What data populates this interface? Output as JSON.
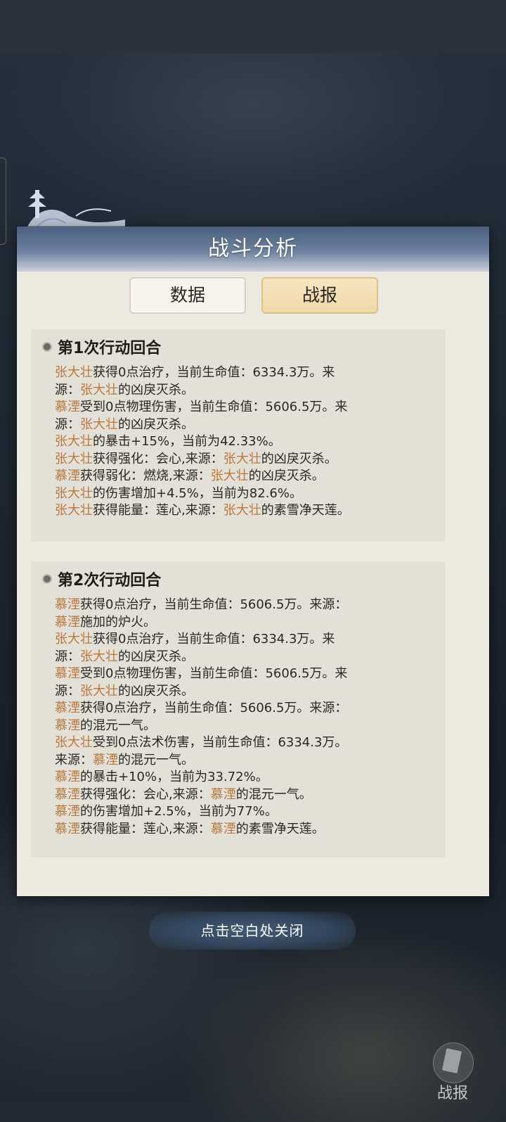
{
  "panel": {
    "title": "战斗分析"
  },
  "tabs": {
    "data": "数据",
    "report": "战报",
    "active": "战报"
  },
  "rounds": [
    {
      "title": "第1次行动回合",
      "lines": [
        [
          [
            "张大壮",
            "hl"
          ],
          [
            "获得0点治疗，当前生命值：6334.3万。来",
            ""
          ]
        ],
        [
          [
            "源：",
            ""
          ],
          [
            "张大壮",
            "hl"
          ],
          [
            "的凶戾灭杀。",
            ""
          ]
        ],
        [
          [
            "慕湮",
            "hl"
          ],
          [
            "受到0点物理伤害，当前生命值：5606.5万。来",
            ""
          ]
        ],
        [
          [
            "源：",
            ""
          ],
          [
            "张大壮",
            "hl"
          ],
          [
            "的凶戾灭杀。",
            ""
          ]
        ],
        [
          [
            "张大壮",
            "hl"
          ],
          [
            "的暴击+15%，当前为42.33%。",
            ""
          ]
        ],
        [
          [
            "张大壮",
            "hl"
          ],
          [
            "获得强化：会心,来源：",
            ""
          ],
          [
            "张大壮",
            "hl"
          ],
          [
            "的凶戾灭杀。",
            ""
          ]
        ],
        [
          [
            "慕湮",
            "hl"
          ],
          [
            "获得弱化：燃烧,来源：",
            ""
          ],
          [
            "张大壮",
            "hl"
          ],
          [
            "的凶戾灭杀。",
            ""
          ]
        ],
        [
          [
            "张大壮",
            "hl"
          ],
          [
            "的伤害增加+4.5%，当前为82.6%。",
            ""
          ]
        ],
        [
          [
            "张大壮",
            "hl"
          ],
          [
            "获得能量：莲心,来源：",
            ""
          ],
          [
            "张大壮",
            "hl"
          ],
          [
            "的素雪净天莲。",
            ""
          ]
        ]
      ]
    },
    {
      "title": "第2次行动回合",
      "lines": [
        [
          [
            "慕湮",
            "hl"
          ],
          [
            "获得0点治疗，当前生命值：5606.5万。来源：",
            ""
          ]
        ],
        [
          [
            "慕湮",
            "hl"
          ],
          [
            "施加的炉火。",
            ""
          ]
        ],
        [
          [
            "张大壮",
            "hl"
          ],
          [
            "获得0点治疗，当前生命值：6334.3万。来",
            ""
          ]
        ],
        [
          [
            "源：",
            ""
          ],
          [
            "张大壮",
            "hl"
          ],
          [
            "的凶戾灭杀。",
            ""
          ]
        ],
        [
          [
            "慕湮",
            "hl"
          ],
          [
            "受到0点物理伤害，当前生命值：5606.5万。来",
            ""
          ]
        ],
        [
          [
            "源：",
            ""
          ],
          [
            "张大壮",
            "hl"
          ],
          [
            "的凶戾灭杀。",
            ""
          ]
        ],
        [
          [
            "慕湮",
            "hl"
          ],
          [
            "获得0点治疗，当前生命值：5606.5万。来源：",
            ""
          ]
        ],
        [
          [
            "慕湮",
            "hl"
          ],
          [
            "的混元一气。",
            ""
          ]
        ],
        [
          [
            "张大壮",
            "hl"
          ],
          [
            "受到0点法术伤害，当前生命值：6334.3万。",
            ""
          ]
        ],
        [
          [
            "来源：",
            ""
          ],
          [
            "慕湮",
            "hl"
          ],
          [
            "的混元一气。",
            ""
          ]
        ],
        [
          [
            "慕湮",
            "hl"
          ],
          [
            "的暴击+10%，当前为33.72%。",
            ""
          ]
        ],
        [
          [
            "慕湮",
            "hl"
          ],
          [
            "获得强化：会心,来源：",
            ""
          ],
          [
            "慕湮",
            "hl"
          ],
          [
            "的混元一气。",
            ""
          ]
        ],
        [
          [
            "慕湮",
            "hl"
          ],
          [
            "的伤害增加+2.5%，当前为77%。",
            ""
          ]
        ],
        [
          [
            "慕湮",
            "hl"
          ],
          [
            "获得能量：莲心,来源：",
            ""
          ],
          [
            "慕湮",
            "hl"
          ],
          [
            "的素雪净天莲。",
            ""
          ]
        ]
      ]
    }
  ],
  "close_hint": "点击空白处关闭",
  "corner_button": {
    "label": "战报",
    "icon": "battle-report-icon"
  },
  "colors": {
    "highlight": "#b87a3c",
    "panel_bg": "#ece9e1",
    "header": "#4d5f7f"
  }
}
